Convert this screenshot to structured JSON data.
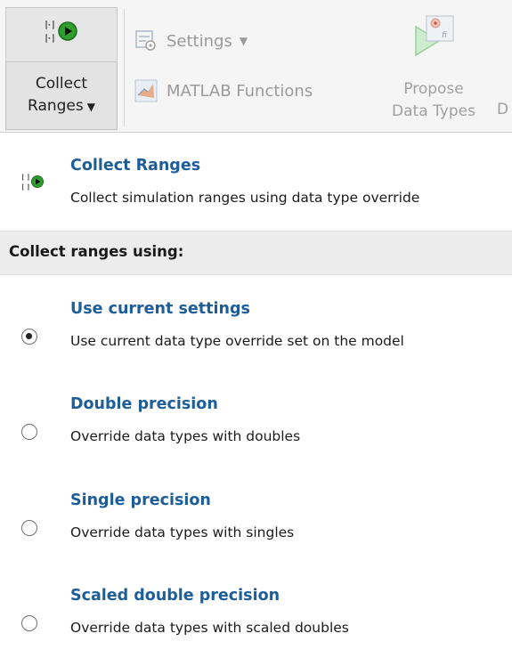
{
  "toolstrip": {
    "collect": {
      "label_line1": "Collect",
      "label_line2": "Ranges",
      "dropdown_glyph": "▼"
    },
    "settings": {
      "label": "Settings",
      "dropdown_glyph": "▼"
    },
    "matlab_functions": {
      "label": "MATLAB Functions"
    },
    "propose": {
      "label_line1": "Propose",
      "label_line2": "Data Types",
      "icon_text": "fi"
    },
    "clipped_label": "D"
  },
  "menu": {
    "header": {
      "title": "Collect Ranges",
      "description": "Collect simulation ranges using data type override"
    },
    "section_title": "Collect ranges using:",
    "options": [
      {
        "title": "Use current settings",
        "description": "Use current data type override set on the model",
        "selected": true
      },
      {
        "title": "Double precision",
        "description": "Override data types with doubles",
        "selected": false
      },
      {
        "title": "Single precision",
        "description": "Override data types with singles",
        "selected": false
      },
      {
        "title": "Scaled double precision",
        "description": "Override data types with scaled doubles",
        "selected": false
      }
    ]
  },
  "colors": {
    "link_blue": "#1d5e9a",
    "play_green": "#2e9e2e",
    "toolstrip_bg": "#f5f5f5",
    "section_bg": "#ececec"
  },
  "icons": [
    "collect-ranges-icon",
    "settings-icon",
    "matlab-icon",
    "propose-data-types-icon",
    "radio-button"
  ]
}
